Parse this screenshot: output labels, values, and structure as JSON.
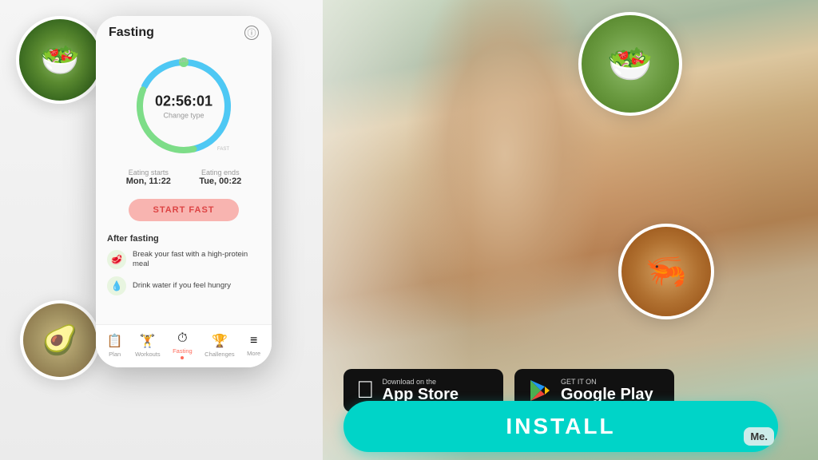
{
  "scene": {
    "background": "#f0efed"
  },
  "phone": {
    "title": "Fasting",
    "timer": "02:56:01",
    "change_type": "Change type",
    "eating_starts_label": "Eating starts",
    "eating_starts_value": "Mon, 11:22",
    "eating_ends_label": "Eating ends",
    "eating_ends_value": "Tue, 00:22",
    "start_fast_btn": "START FAST",
    "after_fasting_title": "After fasting",
    "tips": [
      "Break your fast with a high-protein meal",
      "Drink water if you feel hungry"
    ],
    "nav": [
      {
        "label": "Plan",
        "icon": "📋"
      },
      {
        "label": "Workouts",
        "icon": "🏋️"
      },
      {
        "label": "Fasting",
        "icon": "⏱",
        "active": true
      },
      {
        "label": "Challenges",
        "icon": "🏆"
      },
      {
        "label": "More",
        "icon": "≡"
      }
    ]
  },
  "store_buttons": {
    "app_store": {
      "sub_line1": "Download on the",
      "main": "App Store"
    },
    "google_play": {
      "sub_line1": "GET IT ON",
      "main": "Google Play"
    }
  },
  "install_btn": "INSTALL",
  "me_badge": "Me."
}
